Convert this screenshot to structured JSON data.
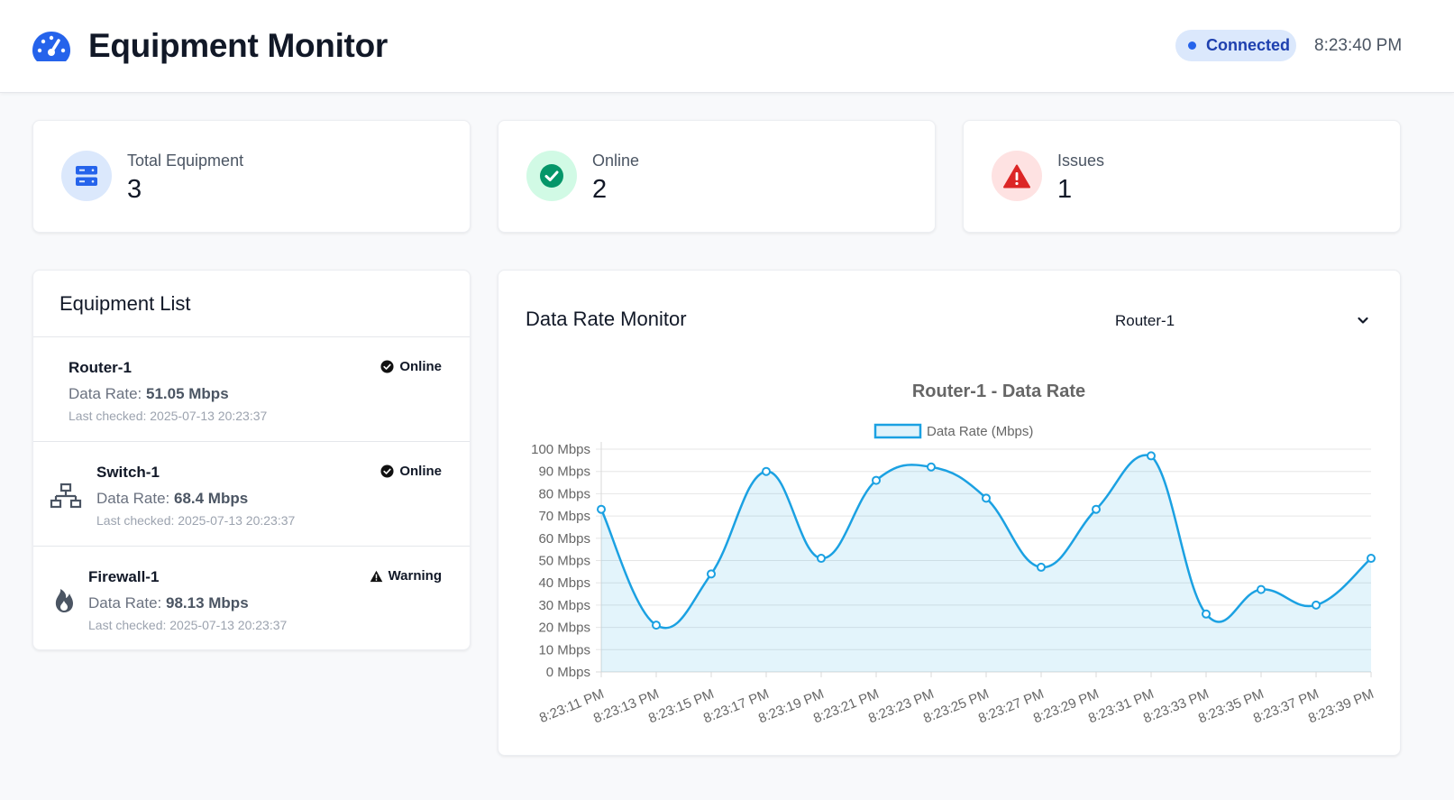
{
  "header": {
    "title": "Equipment Monitor",
    "logo_icon": "gauge-icon",
    "connection_status": "Connected",
    "time": "8:23:40 PM"
  },
  "stats": [
    {
      "label": "Total Equipment",
      "value": "3",
      "icon": "server-icon",
      "color": "#2563eb",
      "bg": "#dbe8fc"
    },
    {
      "label": "Online",
      "value": "2",
      "icon": "check-circle-icon",
      "color": "#059669",
      "bg": "#d1fae5"
    },
    {
      "label": "Issues",
      "value": "1",
      "icon": "warning-icon",
      "color": "#dc2626",
      "bg": "#fee2e2"
    }
  ],
  "equipment_list": {
    "title": "Equipment List",
    "data_rate_label": "Data Rate:",
    "items": [
      {
        "name": "Router-1",
        "icon": "",
        "data_rate": "51.05 Mbps",
        "last_checked": "Last checked: 2025-07-13 20:23:37",
        "status": "Online",
        "status_icon": "check-circle-icon"
      },
      {
        "name": "Switch-1",
        "icon": "network-icon",
        "data_rate": "68.4 Mbps",
        "last_checked": "Last checked: 2025-07-13 20:23:37",
        "status": "Online",
        "status_icon": "check-circle-icon"
      },
      {
        "name": "Firewall-1",
        "icon": "fire-icon",
        "data_rate": "98.13 Mbps",
        "last_checked": "Last checked: 2025-07-13 20:23:37",
        "status": "Warning",
        "status_icon": "warning-icon"
      }
    ]
  },
  "monitor": {
    "title": "Data Rate Monitor",
    "selected_device": "Router-1"
  },
  "chart_data": {
    "type": "line",
    "title": "Router-1 - Data Rate",
    "x": [
      "8:23:11 PM",
      "8:23:13 PM",
      "8:23:15 PM",
      "8:23:17 PM",
      "8:23:19 PM",
      "8:23:21 PM",
      "8:23:23 PM",
      "8:23:25 PM",
      "8:23:27 PM",
      "8:23:29 PM",
      "8:23:31 PM",
      "8:23:33 PM",
      "8:23:35 PM",
      "8:23:37 PM",
      "8:23:39 PM"
    ],
    "series": [
      {
        "name": "Data Rate (Mbps)",
        "values": [
          73,
          21,
          44,
          90,
          51,
          86,
          92,
          78,
          47,
          73,
          97,
          26,
          37,
          30,
          51
        ],
        "color": "#1ba1e2"
      }
    ],
    "y_ticks": [
      "0 Mbps",
      "10 Mbps",
      "20 Mbps",
      "30 Mbps",
      "40 Mbps",
      "50 Mbps",
      "60 Mbps",
      "70 Mbps",
      "80 Mbps",
      "90 Mbps",
      "100 Mbps"
    ],
    "ylim": [
      0,
      100
    ],
    "grid": true,
    "legend": "top-center",
    "fill": true
  }
}
